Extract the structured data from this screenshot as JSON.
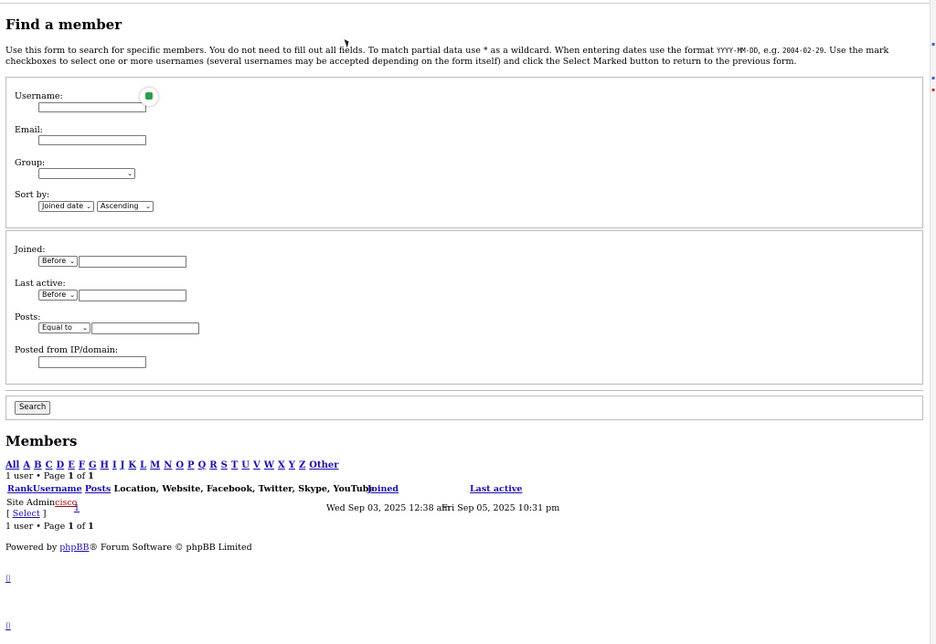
{
  "page": {
    "title": "Find a member"
  },
  "intro": {
    "text1": "Use this form to search for specific members. You do not need to fill out all fields. To match partial data use * as a wildcard. When entering dates use the format ",
    "date_format": "YYYY-MM-DD",
    "text2": ", e.g. ",
    "example_date": "2004-02-29",
    "text3": ". Use the mark checkboxes to select one or more usernames (several usernames may be accepted depending on the form itself) and click the Select Marked button to return to the previous form."
  },
  "form": {
    "username_label": "Username:",
    "email_label": "Email:",
    "group_label": "Group:",
    "sortby_label": "Sort by:",
    "sort_field": "Joined date",
    "sort_order": "Ascending",
    "joined_label": "Joined:",
    "joined_op": "Before",
    "last_active_label": "Last active:",
    "last_active_op": "Before",
    "posts_label": "Posts:",
    "posts_op": "Equal to",
    "ip_label": "Posted from IP/domain:",
    "search_button": "Search"
  },
  "members": {
    "heading": "Members",
    "letters": [
      "All",
      "A",
      "B",
      "C",
      "D",
      "E",
      "F",
      "G",
      "H",
      "I",
      "J",
      "K",
      "L",
      "M",
      "N",
      "O",
      "P",
      "Q",
      "R",
      "S",
      "T",
      "U",
      "V",
      "W",
      "X",
      "Y",
      "Z",
      "Other"
    ],
    "pagination_prefix": "1 user • Page ",
    "page_current": "1",
    "page_of": " of ",
    "page_total": "1",
    "columns": {
      "rank": "Rank",
      "username": "Username",
      "posts": "Posts",
      "info": "Location, Website, Facebook, Twitter, Skype, YouTube",
      "joined": "Joined",
      "last_active": "Last active"
    },
    "row": {
      "rank": "Site Admin",
      "username": "cisco",
      "posts": "1",
      "select": "Select",
      "joined": "Wed Sep 03, 2025 12:38 am",
      "last_active": "Fri Sep 05, 2025 10:31 pm"
    }
  },
  "footer": {
    "powered_by": "Powered by ",
    "phpbb_link": "phpBB",
    "powered_suffix": "® Forum Software © phpBB Limited",
    "glyph1": "⌷",
    "glyph2": "⌷"
  },
  "colors": {
    "link": "#1a0dab",
    "username": "#aa0000",
    "badge": "#2e9e44"
  }
}
